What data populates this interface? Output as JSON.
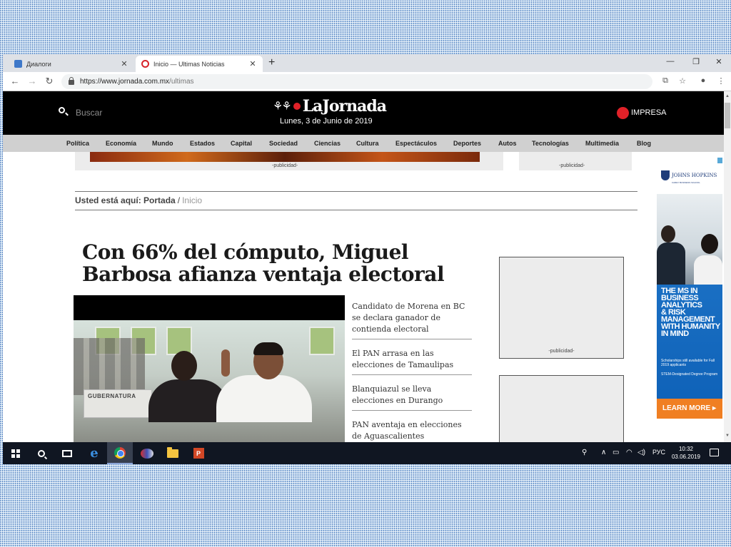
{
  "browser": {
    "tabs": [
      {
        "title": "Диалоги",
        "close": "✕"
      },
      {
        "title": "Inicio — Ultimas Noticias",
        "close": "✕"
      }
    ],
    "new_tab": "+",
    "window_controls": {
      "minimize": "—",
      "restore": "❐",
      "close": "✕"
    },
    "nav": {
      "back": "←",
      "forward": "→",
      "reload": "↻"
    },
    "url": {
      "host": "https://www.jornada.com.mx",
      "path": "/ultimas"
    },
    "toolbar_icons": {
      "translate": "⧉",
      "bookmark": "☆",
      "profile": "●",
      "menu": "⋮"
    }
  },
  "site": {
    "search_placeholder": "Buscar",
    "logo_mark": "⚘⚘",
    "logo_text": "LaJornada",
    "date": "Lunes, 3 de Junio de 2019",
    "impresa": "IMPRESA",
    "nav": [
      "Política",
      "Economía",
      "Mundo",
      "Estados",
      "Capital",
      "Sociedad",
      "Ciencias",
      "Cultura",
      "Espectáculos",
      "Deportes",
      "Autos",
      "Tecnologías",
      "Multimedia",
      "Blog"
    ]
  },
  "ads": {
    "label": "-publicidad-"
  },
  "breadcrumb": {
    "prefix": "Usted está aquí:",
    "home": "Portada",
    "separator": "/",
    "current": "Inicio"
  },
  "article": {
    "headline": "Con 66% del cómputo, Miguel Barbosa afianza ventaja electoral",
    "photo_sign": "GUBERNATURA",
    "related": [
      "Candidato de Morena en BC se declara ganador de contienda electoral",
      "El PAN arrasa en las elecciones de Tamaulipas",
      "Blanquiazul se lleva elecciones en Durango",
      "PAN aventaja en elecciones de Aguascalientes"
    ]
  },
  "side_ad": {
    "brand": "JOHNS HOPKINS",
    "brand_sub": "CAREY BUSINESS SCHOOL",
    "headline_lines": [
      "THE MS IN",
      "BUSINESS",
      "ANALYTICS",
      "& RISK",
      "MANAGEMENT",
      "WITH HUMANITY",
      "IN MIND"
    ],
    "note1": "Scholarships still available for Fall 2019 applicants",
    "note2": "STEM-Designated Degree Program",
    "cta": "LEARN MORE ▸"
  },
  "taskbar": {
    "tray_person": "⚲",
    "tray_chevron": "∧",
    "tray_battery": "▭",
    "tray_wifi": "◠",
    "tray_volume": "◁)",
    "lang": "РУС",
    "time": "10:32",
    "date": "03.06.2019",
    "ppt_letter": "P"
  },
  "colors": {
    "header_bg": "#000000",
    "nav_bg": "#d0d0d0",
    "logo_dot": "#e02128",
    "ad_blue": "#1a6fc3",
    "cta_orange": "#f07f22",
    "taskbar_bg": "#101622"
  }
}
